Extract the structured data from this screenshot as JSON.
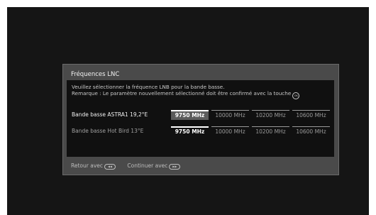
{
  "dialog": {
    "title": "Fréquences LNC",
    "info_line1": "Veuillez sélectionner la fréquence LNB pour la bande basse.",
    "info_line2": "Remarque : Le paramètre nouvellement sélectionné doit être confirmé avec la touche",
    "ok_icon": "ok-key-icon"
  },
  "rows": [
    {
      "label": "Bande basse ASTRA1 19,2°E",
      "options": [
        "9750 MHz",
        "10000 MHz",
        "10200 MHz",
        "10600 MHz"
      ],
      "selected": "9750 MHz"
    },
    {
      "label": "Bande basse Hot Bird 13°E",
      "options": [
        "9750 MHz",
        "10000 MHz",
        "10200 MHz",
        "10600 MHz"
      ],
      "selected": "9750 MHz"
    }
  ],
  "footer": {
    "back_label": "Retour avec",
    "back_icon": "rewind-key-icon",
    "continue_label": "Continuer avec",
    "continue_icon": "forward-key-icon"
  },
  "colors": {
    "screen_bg": "#151515",
    "dialog_bg": "#4a4a4a",
    "panel_bg": "#101010",
    "selected_text": "#ffffff",
    "unselected_text": "#9a9a9a"
  }
}
